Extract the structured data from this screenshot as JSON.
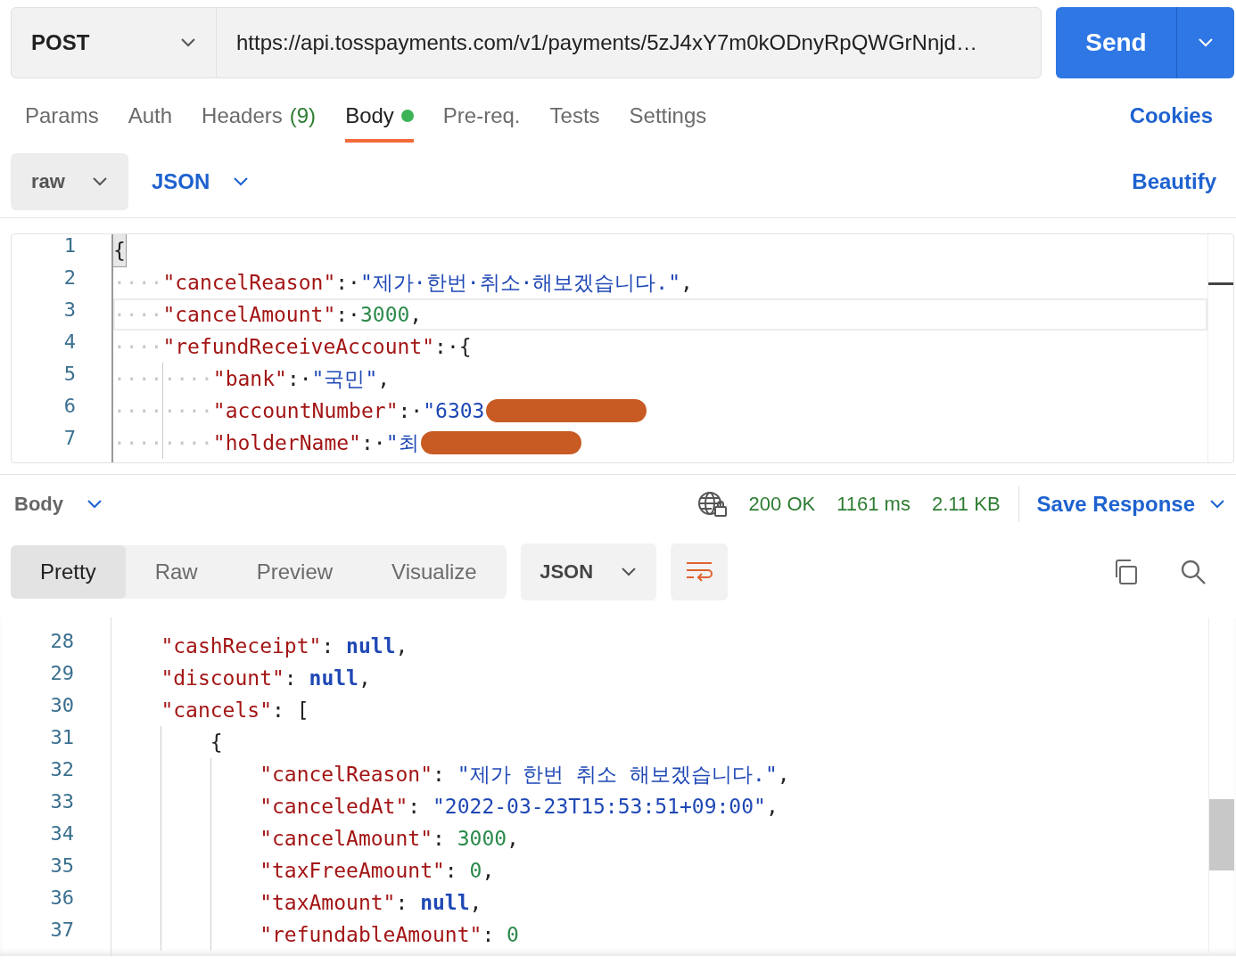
{
  "request": {
    "method": "POST",
    "url": "https://api.tosspayments.com/v1/payments/5zJ4xY7m0kODnyRpQWGrNnjd…",
    "send": "Send"
  },
  "tabs": [
    {
      "label": "Params",
      "selected": false,
      "dot": false
    },
    {
      "label": "Auth",
      "selected": false,
      "dot": false
    },
    {
      "label": "Headers",
      "count": "(9)",
      "selected": false,
      "dot": false
    },
    {
      "label": "Body",
      "selected": true,
      "dot": true
    },
    {
      "label": "Pre-req.",
      "selected": false,
      "dot": false
    },
    {
      "label": "Tests",
      "selected": false,
      "dot": false
    },
    {
      "label": "Settings",
      "selected": false,
      "dot": false
    }
  ],
  "cookies": "Cookies",
  "body_mode": {
    "type": "raw",
    "language": "JSON",
    "beautify": "Beautify"
  },
  "editor": {
    "lines": [
      {
        "number": "1",
        "active": false,
        "tokens": [
          {
            "kind": "match",
            "text": "{"
          }
        ]
      },
      {
        "number": "2",
        "active": false,
        "tokens": [
          {
            "kind": "ws",
            "text": "····"
          },
          {
            "kind": "key",
            "text": "\"cancelReason\""
          },
          {
            "kind": "punct",
            "text": ":·"
          },
          {
            "kind": "string",
            "text": "\"제가·한번·취소·해보겠습니다.\""
          },
          {
            "kind": "punct",
            "text": ","
          }
        ]
      },
      {
        "number": "3",
        "active": true,
        "tokens": [
          {
            "kind": "ws",
            "text": "····"
          },
          {
            "kind": "key",
            "text": "\"cancelAmount\""
          },
          {
            "kind": "punct",
            "text": ":·"
          },
          {
            "kind": "number",
            "text": "3000"
          },
          {
            "kind": "punct",
            "text": ","
          }
        ]
      },
      {
        "number": "4",
        "active": false,
        "tokens": [
          {
            "kind": "ws",
            "text": "····"
          },
          {
            "kind": "key",
            "text": "\"refundReceiveAccount\""
          },
          {
            "kind": "punct",
            "text": ":·{"
          }
        ]
      },
      {
        "number": "5",
        "active": false,
        "tokens": [
          {
            "kind": "ws",
            "text": "····"
          },
          {
            "kind": "guide",
            "text": "····"
          },
          {
            "kind": "key",
            "text": "\"bank\""
          },
          {
            "kind": "punct",
            "text": ":·"
          },
          {
            "kind": "string",
            "text": "\"국민\""
          },
          {
            "kind": "punct",
            "text": ","
          }
        ]
      },
      {
        "number": "6",
        "active": false,
        "redacted": true,
        "tokens": [
          {
            "kind": "ws",
            "text": "····"
          },
          {
            "kind": "guide",
            "text": "····"
          },
          {
            "kind": "key",
            "text": "\"accountNumber\""
          },
          {
            "kind": "punct",
            "text": ":·"
          },
          {
            "kind": "string",
            "text": "\"6303"
          }
        ]
      },
      {
        "number": "7",
        "active": false,
        "redacted": true,
        "tokens": [
          {
            "kind": "ws",
            "text": "····"
          },
          {
            "kind": "guide",
            "text": "····"
          },
          {
            "kind": "key",
            "text": "\"holderName\""
          },
          {
            "kind": "punct",
            "text": ":·"
          },
          {
            "kind": "string",
            "text": "\"최"
          }
        ]
      }
    ]
  },
  "response": {
    "label": "Body",
    "status": "200 OK",
    "time": "1161 ms",
    "size": "2.11 KB",
    "save": "Save Response",
    "views": [
      {
        "label": "Pretty",
        "selected": true
      },
      {
        "label": "Raw",
        "selected": false
      },
      {
        "label": "Preview",
        "selected": false
      },
      {
        "label": "Visualize",
        "selected": false
      }
    ],
    "format": "JSON",
    "lines": [
      {
        "number": "28",
        "tokens": [
          {
            "kind": "indent"
          },
          {
            "kind": "key",
            "text": "\"cashReceipt\""
          },
          {
            "kind": "punct",
            "text": ": "
          },
          {
            "kind": "null",
            "text": "null"
          },
          {
            "kind": "punct",
            "text": ","
          }
        ]
      },
      {
        "number": "29",
        "tokens": [
          {
            "kind": "indent"
          },
          {
            "kind": "key",
            "text": "\"discount\""
          },
          {
            "kind": "punct",
            "text": ": "
          },
          {
            "kind": "null",
            "text": "null"
          },
          {
            "kind": "punct",
            "text": ","
          }
        ]
      },
      {
        "number": "30",
        "tokens": [
          {
            "kind": "indent"
          },
          {
            "kind": "key",
            "text": "\"cancels\""
          },
          {
            "kind": "punct",
            "text": ": ["
          }
        ]
      },
      {
        "number": "31",
        "tokens": [
          {
            "kind": "indent"
          },
          {
            "kind": "guide_indent"
          },
          {
            "kind": "punct",
            "text": "{"
          }
        ]
      },
      {
        "number": "32",
        "tokens": [
          {
            "kind": "indent"
          },
          {
            "kind": "guide_indent"
          },
          {
            "kind": "guide_indent"
          },
          {
            "kind": "key",
            "text": "\"cancelReason\""
          },
          {
            "kind": "punct",
            "text": ": "
          },
          {
            "kind": "string",
            "text": "\"제가 한번 취소 해보겠습니다.\""
          },
          {
            "kind": "punct",
            "text": ","
          }
        ]
      },
      {
        "number": "33",
        "tokens": [
          {
            "kind": "indent"
          },
          {
            "kind": "guide_indent"
          },
          {
            "kind": "guide_indent"
          },
          {
            "kind": "key",
            "text": "\"canceledAt\""
          },
          {
            "kind": "punct",
            "text": ": "
          },
          {
            "kind": "string",
            "text": "\"2022-03-23T15:53:51+09:00\""
          },
          {
            "kind": "punct",
            "text": ","
          }
        ]
      },
      {
        "number": "34",
        "tokens": [
          {
            "kind": "indent"
          },
          {
            "kind": "guide_indent"
          },
          {
            "kind": "guide_indent"
          },
          {
            "kind": "key",
            "text": "\"cancelAmount\""
          },
          {
            "kind": "punct",
            "text": ": "
          },
          {
            "kind": "number",
            "text": "3000"
          },
          {
            "kind": "punct",
            "text": ","
          }
        ]
      },
      {
        "number": "35",
        "tokens": [
          {
            "kind": "indent"
          },
          {
            "kind": "guide_indent"
          },
          {
            "kind": "guide_indent"
          },
          {
            "kind": "key",
            "text": "\"taxFreeAmount\""
          },
          {
            "kind": "punct",
            "text": ": "
          },
          {
            "kind": "number",
            "text": "0"
          },
          {
            "kind": "punct",
            "text": ","
          }
        ]
      },
      {
        "number": "36",
        "tokens": [
          {
            "kind": "indent"
          },
          {
            "kind": "guide_indent"
          },
          {
            "kind": "guide_indent"
          },
          {
            "kind": "key",
            "text": "\"taxAmount\""
          },
          {
            "kind": "punct",
            "text": ": "
          },
          {
            "kind": "null",
            "text": "null"
          },
          {
            "kind": "punct",
            "text": ","
          }
        ]
      },
      {
        "number": "37",
        "tokens": [
          {
            "kind": "indent"
          },
          {
            "kind": "guide_indent"
          },
          {
            "kind": "guide_indent"
          },
          {
            "kind": "key",
            "text": "\"refundableAmount\""
          },
          {
            "kind": "punct",
            "text": ": "
          },
          {
            "kind": "number",
            "text": "0"
          }
        ]
      }
    ]
  }
}
